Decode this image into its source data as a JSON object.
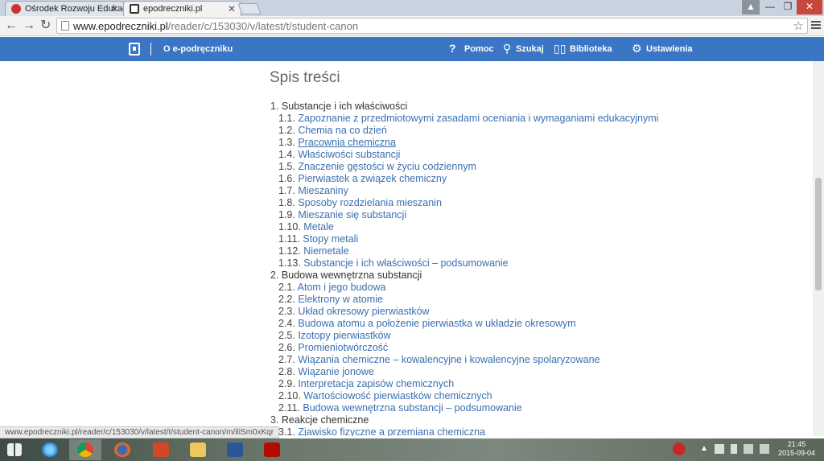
{
  "browser": {
    "tabs": [
      {
        "title": "Ośrodek Rozwoju Edukacj",
        "active": false
      },
      {
        "title": "epodreczniki.pl",
        "active": true
      }
    ],
    "url_host": "www.epodreczniki.pl",
    "url_path": "/reader/c/153030/v/latest/t/student-canon",
    "status_url": "www.epodreczniki.pl/reader/c/153030/v/latest/t/student-canon/m/iliSm0xKqr"
  },
  "appbar": {
    "about": "O e-podręczniku",
    "help": "Pomoc",
    "search": "Szukaj",
    "library": "Biblioteka",
    "settings": "Ustawienia"
  },
  "toc": {
    "title": "Spis treści",
    "rows": [
      {
        "num": "1. ",
        "label": "Substancje i ich właściwości",
        "kind": "chapter"
      },
      {
        "num": "1.1. ",
        "label": "Zapoznanie z przedmiotowymi zasadami oceniania i wymaganiami edukacyjnymi",
        "kind": "sub"
      },
      {
        "num": "1.2. ",
        "label": "Chemia na co dzień",
        "kind": "sub"
      },
      {
        "num": "1.3. ",
        "label": "Pracownia chemiczna",
        "kind": "sub",
        "hover": true
      },
      {
        "num": "1.4. ",
        "label": "Właściwości substancji",
        "kind": "sub"
      },
      {
        "num": "1.5. ",
        "label": "Znaczenie gęstości w życiu codziennym",
        "kind": "sub"
      },
      {
        "num": "1.6. ",
        "label": "Pierwiastek a związek chemiczny",
        "kind": "sub"
      },
      {
        "num": "1.7. ",
        "label": "Mieszaniny",
        "kind": "sub"
      },
      {
        "num": "1.8. ",
        "label": "Sposoby rozdzielania mieszanin",
        "kind": "sub"
      },
      {
        "num": "1.9. ",
        "label": "Mieszanie się substancji",
        "kind": "sub"
      },
      {
        "num": "1.10. ",
        "label": "Metale",
        "kind": "sub"
      },
      {
        "num": "1.11. ",
        "label": "Stopy metali",
        "kind": "sub"
      },
      {
        "num": "1.12. ",
        "label": "Niemetale",
        "kind": "sub"
      },
      {
        "num": "1.13. ",
        "label": "Substancje i ich właściwości – podsumowanie",
        "kind": "sub"
      },
      {
        "num": "2. ",
        "label": "Budowa wewnętrzna substancji",
        "kind": "chapter"
      },
      {
        "num": "2.1. ",
        "label": "Atom i jego budowa",
        "kind": "sub"
      },
      {
        "num": "2.2. ",
        "label": "Elektrony w atomie",
        "kind": "sub"
      },
      {
        "num": "2.3. ",
        "label": "Układ okresowy pierwiastków",
        "kind": "sub"
      },
      {
        "num": "2.4. ",
        "label": "Budowa atomu a położenie pierwiastka w układzie okresowym",
        "kind": "sub"
      },
      {
        "num": "2.5. ",
        "label": "Izotopy pierwiastków",
        "kind": "sub"
      },
      {
        "num": "2.6. ",
        "label": "Promieniotwórczość",
        "kind": "sub"
      },
      {
        "num": "2.7. ",
        "label": "Wiązania chemiczne – kowalencyjne i kowalencyjne spolaryzowane",
        "kind": "sub"
      },
      {
        "num": "2.8. ",
        "label": "Wiązanie jonowe",
        "kind": "sub"
      },
      {
        "num": "2.9. ",
        "label": "Interpretacja zapisów chemicznych",
        "kind": "sub"
      },
      {
        "num": "2.10. ",
        "label": "Wartościowość pierwiastków chemicznych",
        "kind": "sub"
      },
      {
        "num": "2.11. ",
        "label": "Budowa wewnętrzna substancji – podsumowanie",
        "kind": "sub"
      },
      {
        "num": "3. ",
        "label": "Reakcje chemiczne",
        "kind": "chapter"
      },
      {
        "num": "3.1. ",
        "label": "Zjawisko fizyczne a przemiana chemiczna",
        "kind": "sub"
      }
    ]
  },
  "taskbar": {
    "time": "21:45",
    "date": "2015-09-04",
    "apps": [
      "windows-start",
      "internet-explorer",
      "chrome",
      "firefox",
      "powerpoint",
      "file-explorer",
      "word",
      "acrobat"
    ]
  },
  "colors": {
    "appbar": "#3a76c4",
    "link": "#3a6fb0"
  }
}
